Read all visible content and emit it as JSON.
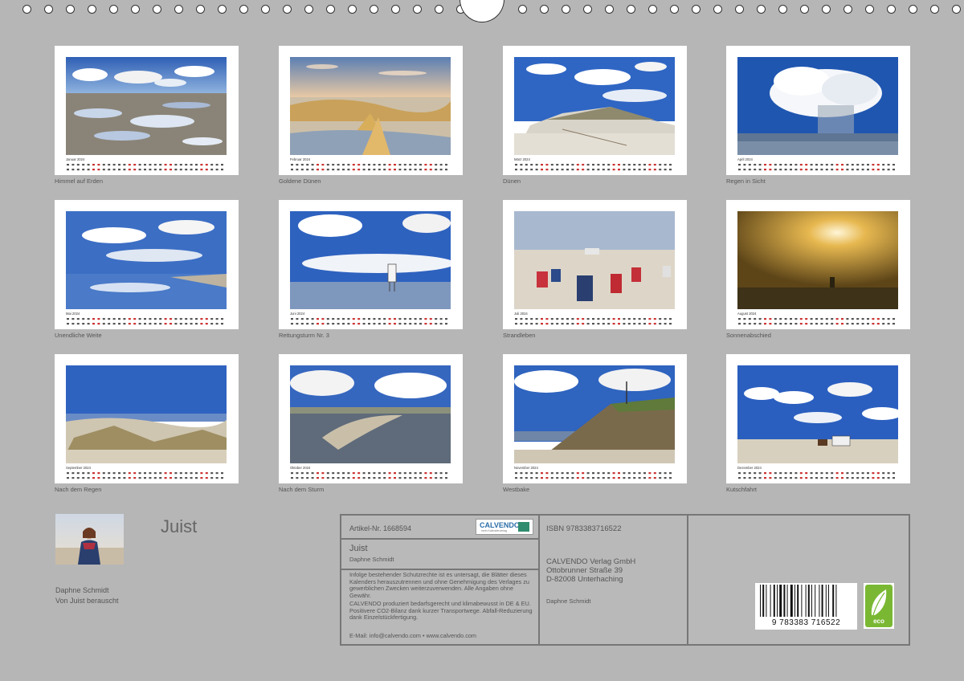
{
  "months": [
    {
      "label": "Januar 2024",
      "caption": "Himmel auf Erden"
    },
    {
      "label": "Februar 2024",
      "caption": "Goldene Dünen"
    },
    {
      "label": "März 2024",
      "caption": "Dünen"
    },
    {
      "label": "April 2024",
      "caption": "Regen in Sicht"
    },
    {
      "label": "Mai 2024",
      "caption": "Unendliche Weite"
    },
    {
      "label": "Juni 2024",
      "caption": "Rettungsturm Nr. 3"
    },
    {
      "label": "Juli 2024",
      "caption": "Strandleben"
    },
    {
      "label": "August 2024",
      "caption": "Sonnenabschied"
    },
    {
      "label": "September 2024",
      "caption": "Nach dem Regen"
    },
    {
      "label": "Oktober 2024",
      "caption": "Nach dem Sturm"
    },
    {
      "label": "November 2024",
      "caption": "Westbake"
    },
    {
      "label": "Dezember 2024",
      "caption": "Kutschfahrt"
    }
  ],
  "cover": {
    "title": "Juist",
    "author": "Daphne Schmidt",
    "subtitle": "Von Juist berauscht"
  },
  "info": {
    "article": "Artikel-Nr. 1668594",
    "logo_text": "CALVENDO",
    "logo_sub": "mein Kalenderverlag",
    "title": "Juist",
    "author": "Daphne Schmidt",
    "legal": "Infolge bestehender Schutzrechte ist es untersagt, die Blätter dieses Kalenders herauszutrennen und ohne Genehmigung des Verlages zu gewerblichen Zwecken weiterzuverwenden. Alle Angaben ohne Gewähr.",
    "eco_note": "CALVENDO produziert bedarfsgerecht und klimabewusst in DE & EU. Positivere CO2-Bilanz dank kurzer Transportwege. Abfall-Reduzierung dank Einzelstückfertigung.",
    "contact": "E-Mail: info@calvendo.com • www.calvendo.com",
    "isbn": "ISBN 9783383716522",
    "publisher_name": "CALVENDO Verlag GmbH",
    "publisher_street": "Ottobrunner Straße 39",
    "publisher_city": "D-82008 Unterhaching",
    "publisher_author": "Daphne Schmidt",
    "barcode_digits": "9 783383 716522",
    "eco_label": "eco"
  },
  "colors": {
    "background": "#b6b6b6",
    "sky": "#3f6fc0",
    "sand": "#d7cfbf",
    "sunset": "#b8862e",
    "eco_green": "#7ab833",
    "weekend": "#cc3333"
  }
}
